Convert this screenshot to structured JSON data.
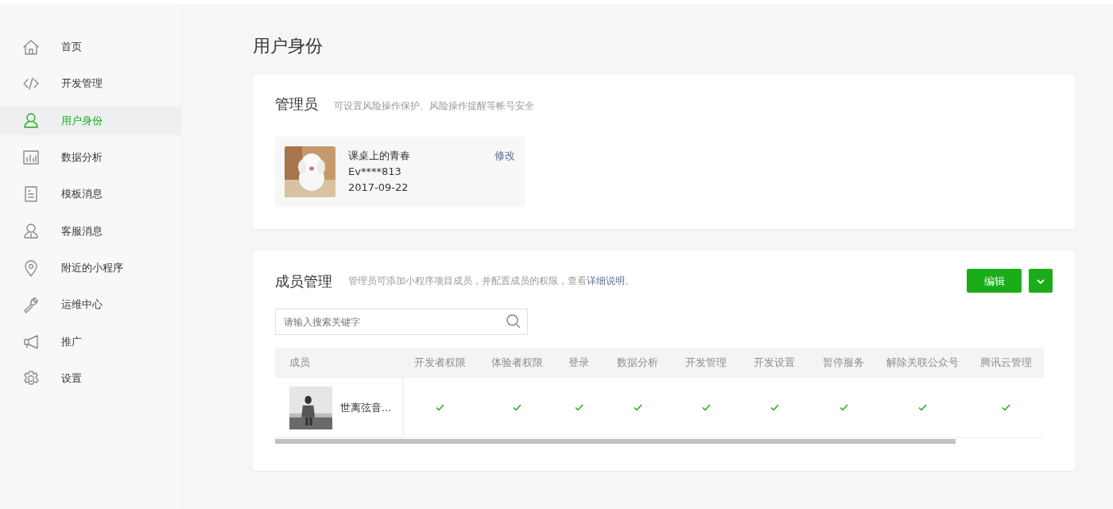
{
  "sidebar": {
    "items": [
      {
        "label": "首页",
        "selected": false
      },
      {
        "label": "开发管理",
        "selected": false
      },
      {
        "label": "用户身份",
        "selected": true
      },
      {
        "label": "数据分析",
        "selected": false
      },
      {
        "label": "模板消息",
        "selected": false
      },
      {
        "label": "客服消息",
        "selected": false
      },
      {
        "label": "附近的小程序",
        "selected": false
      },
      {
        "label": "运维中心",
        "selected": false
      },
      {
        "label": "推广",
        "selected": false
      },
      {
        "label": "设置",
        "selected": false
      }
    ]
  },
  "page_title": "用户身份",
  "admin": {
    "title": "管理员",
    "description": "可设置风险操作保护、风险操作提醒等帐号安全",
    "profile": {
      "avatar": {
        "kind": "picture"
      },
      "name": "课桌上的青春",
      "account": "Ev****813",
      "date": "2017-09-22",
      "action": "修改"
    }
  },
  "members": {
    "title": "成员管理",
    "description_text": "管理员可添加小程序项目成员，并配置成员的权限，查看",
    "description_link": "详细说明",
    "description_end": "。",
    "edit_button": "编辑",
    "search": {
      "placeholder": "请输入搜索关键字"
    },
    "table": {
      "columns": [
        "成员",
        "开发者权限",
        "体验者权限",
        "登录",
        "数据分析",
        "开发管理",
        "开发设置",
        "暂停服务",
        "解除关联公众号",
        "腾讯云管理"
      ],
      "rows": [
        {
          "avatar": {
            "kind": "picture"
          },
          "name": "世离弦音...",
          "permissions": [
            true,
            true,
            true,
            true,
            true,
            true,
            true,
            true,
            true
          ]
        }
      ]
    }
  }
}
